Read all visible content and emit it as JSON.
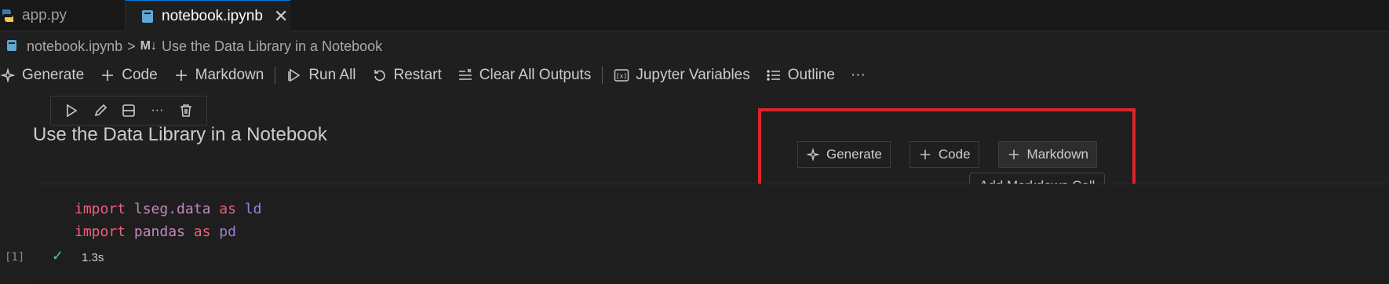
{
  "tabs": [
    {
      "label": "app.py",
      "icon": "python-file-icon",
      "active": false
    },
    {
      "label": "notebook.ipynb",
      "icon": "notebook-file-icon",
      "active": true
    }
  ],
  "breadcrumb": {
    "file": "notebook.ipynb",
    "separator": ">",
    "section_icon": "M↓",
    "section": "Use the Data Library in a Notebook"
  },
  "toolbar": {
    "generate": "Generate",
    "code": "Code",
    "markdown": "Markdown",
    "run_all": "Run All",
    "restart": "Restart",
    "clear_all_outputs": "Clear All Outputs",
    "jupyter_variables": "Jupyter Variables",
    "outline": "Outline",
    "more": "···"
  },
  "cell_toolbar": {
    "more": "···"
  },
  "markdown_cell": {
    "heading": "Use the Data Library in a Notebook"
  },
  "insert_bar": {
    "generate": "Generate",
    "code": "Code",
    "markdown": "Markdown",
    "tooltip": "Add Markdown Cell"
  },
  "code_cell": {
    "line1": {
      "kw1": "import",
      "module": "lseg.data",
      "kw2": "as",
      "alias": "ld"
    },
    "line2": {
      "kw1": "import",
      "module": "pandas",
      "kw2": "as",
      "alias": "pd"
    },
    "execution_count": "[1]",
    "duration": "1.3s"
  },
  "colors": {
    "highlight_box": "#e0242b",
    "keyword": "#f15e80",
    "module": "#c586c0",
    "success": "#4ec978",
    "accent": "#0078d4"
  }
}
